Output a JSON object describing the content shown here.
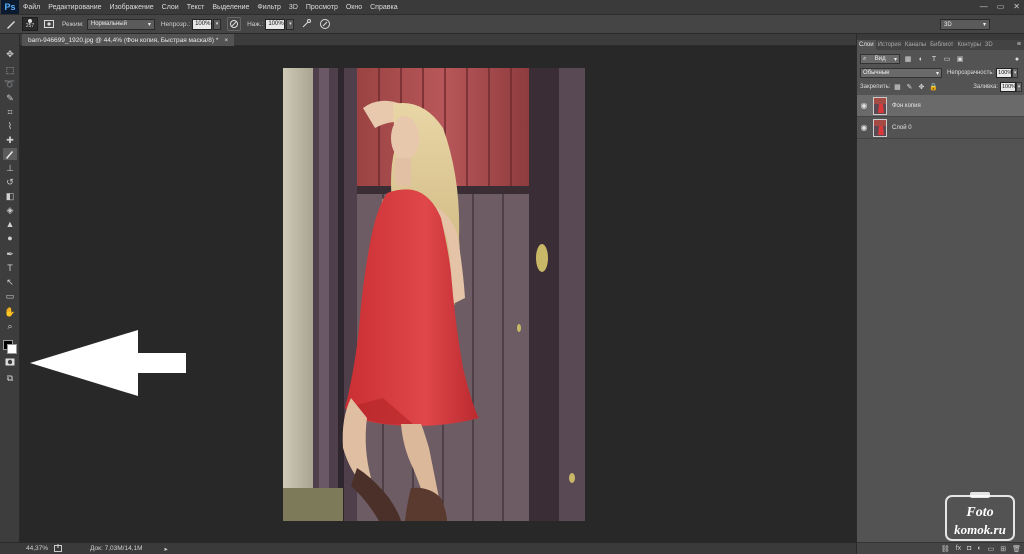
{
  "app": {
    "logo": "Ps"
  },
  "menu": [
    "Файл",
    "Редактирование",
    "Изображение",
    "Слои",
    "Текст",
    "Выделение",
    "Фильтр",
    "3D",
    "Просмотр",
    "Окно",
    "Справка"
  ],
  "window_controls": {
    "minimize": "—",
    "maximize": "▭",
    "close": "✕"
  },
  "options": {
    "brush_size": "257",
    "mode_label": "Режим:",
    "mode_value": "Нормальный",
    "opacity_label": "Непрозр.:",
    "opacity_value": "100%",
    "flow_label": "Наж.:",
    "flow_value": "100%",
    "workspace": "3D"
  },
  "document": {
    "tab_title": "barn-946699_1920.jpg @ 44,4% (Фон копия, Быстрая маска/8) *",
    "tab_close": "×"
  },
  "status": {
    "zoom": "44,37%",
    "doc_info": "Док: 7,03M/14,1M",
    "arrow": "▸"
  },
  "panel": {
    "tabs": [
      "Слои",
      "История",
      "Каналы",
      "Библиот",
      "Контуры",
      "3D"
    ],
    "menu_glyph": "≡",
    "kind": "Вид",
    "blend_mode": "Обычные",
    "opacity_label": "Непрозрачность:",
    "opacity_value": "100%",
    "lock_label": "Закрепить:",
    "fill_label": "Заливка:",
    "fill_value": "100%",
    "layers": [
      {
        "name": "Фон копия",
        "selected": true
      },
      {
        "name": "Слой 0",
        "selected": false
      }
    ],
    "bottom_icons": [
      "link-icon",
      "fx-icon",
      "mask-icon",
      "adjustment-icon",
      "group-icon",
      "new-layer-icon",
      "trash-icon"
    ]
  },
  "watermark": {
    "line1": "Foto",
    "line2": "komok.ru"
  },
  "colors": {
    "menubar": "#3a3a3a",
    "panel": "#535353",
    "canvas": "#282828",
    "dress": "#d9393a",
    "barn_red": "#a34a44"
  }
}
